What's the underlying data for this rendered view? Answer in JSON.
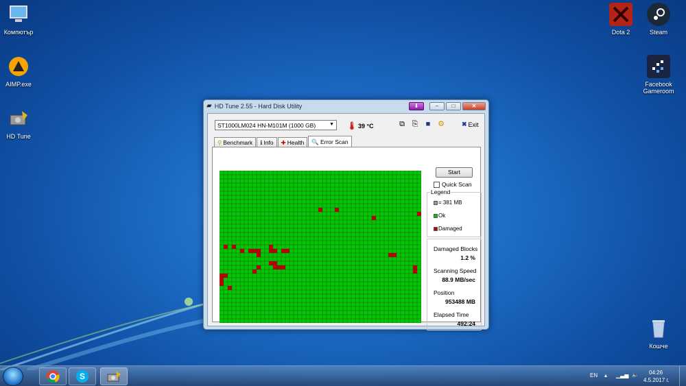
{
  "desktop": {
    "left_icons": [
      {
        "label": "Компютър",
        "icon": "computer-icon"
      },
      {
        "label": "AIMP.exe",
        "icon": "aimp-icon"
      },
      {
        "label": "HD Tune",
        "icon": "hdtune-icon"
      }
    ],
    "right_icons": [
      {
        "label": "Dota 2",
        "icon": "dota2-icon"
      },
      {
        "label": "Steam",
        "icon": "steam-icon"
      },
      {
        "label": "Facebook Gameroom",
        "icon": "gameroom-icon"
      },
      {
        "label": "Кошче",
        "icon": "recycle-bin-icon"
      }
    ]
  },
  "window": {
    "title": "HD Tune 2.55 - Hard Disk Utility",
    "drive": "ST1000LM024 HN-M101M (1000 GB)",
    "temperature": "39 °C",
    "exit_label": "Exit",
    "tabs": [
      {
        "label": "Benchmark",
        "icon": "benchmark-icon"
      },
      {
        "label": "Info",
        "icon": "info-icon"
      },
      {
        "label": "Health",
        "icon": "health-icon"
      },
      {
        "label": "Error Scan",
        "icon": "error-scan-icon"
      }
    ],
    "active_tab": "Error Scan",
    "start_label": "Start",
    "quick_scan_label": "Quick Scan",
    "quick_scan_checked": false,
    "legend": {
      "title": "Legend",
      "block_size": "= 381 MB",
      "ok": "Ok",
      "damaged": "Damaged"
    },
    "stats": [
      {
        "label": "Damaged Blocks",
        "value": "1.2 %"
      },
      {
        "label": "Scanning Speed",
        "value": "88.9 MB/sec"
      },
      {
        "label": "Position",
        "value": "953488 MB"
      },
      {
        "label": "Elapsed Time",
        "value": "492:24"
      }
    ]
  },
  "scan_grid": {
    "columns": 49,
    "rows": 37,
    "ok_color": "#00c800",
    "damaged_color": "#c00000",
    "gridline_color": "#333333",
    "damaged_cells": [
      [
        24,
        9
      ],
      [
        28,
        9
      ],
      [
        37,
        11
      ],
      [
        48,
        10
      ],
      [
        1,
        18
      ],
      [
        3,
        18
      ],
      [
        5,
        19
      ],
      [
        7,
        19
      ],
      [
        8,
        19
      ],
      [
        9,
        19
      ],
      [
        12,
        18
      ],
      [
        12,
        19
      ],
      [
        9,
        20
      ],
      [
        13,
        19
      ],
      [
        15,
        19
      ],
      [
        16,
        19
      ],
      [
        41,
        20
      ],
      [
        42,
        20
      ],
      [
        12,
        22
      ],
      [
        13,
        22
      ],
      [
        9,
        23
      ],
      [
        13,
        23
      ],
      [
        14,
        23
      ],
      [
        15,
        23
      ],
      [
        8,
        24
      ],
      [
        47,
        23
      ],
      [
        0,
        25
      ],
      [
        1,
        25
      ],
      [
        47,
        24
      ],
      [
        0,
        26
      ],
      [
        0,
        27
      ],
      [
        2,
        28
      ]
    ]
  },
  "taskbar": {
    "lang": "EN",
    "time": "04:26",
    "date": "4.5.2017 г.",
    "apps": [
      "chrome-icon",
      "skype-icon",
      "hdtune-icon"
    ]
  },
  "colors": {
    "ok": "#00c800",
    "damaged": "#c00000"
  }
}
